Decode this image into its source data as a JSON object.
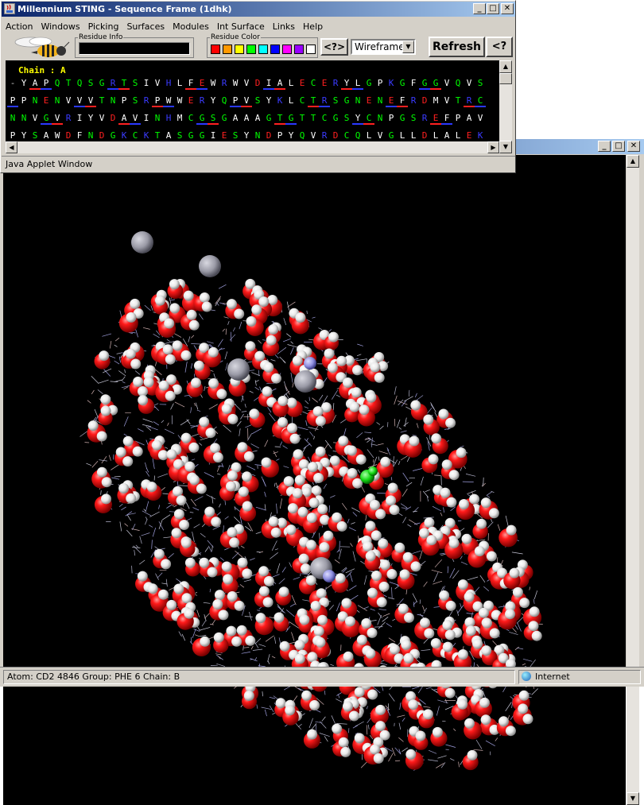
{
  "viewer": {
    "status": {
      "atom_info": "Atom: CD2 4846  Group: PHE 6  Chain: B",
      "zone": "Internet"
    }
  },
  "sequence_frame": {
    "title": "Millennium STING - Sequence Frame (1dhk)",
    "menu": [
      "Action",
      "Windows",
      "Picking",
      "Surfaces",
      "Modules",
      "Int Surface",
      "Links",
      "Help"
    ],
    "residue_info_label": "Residue Info",
    "residue_color_label": "Residue Color",
    "swatches": [
      "#ff0000",
      "#ff9900",
      "#ffff00",
      "#00ff00",
      "#00ffff",
      "#0000ff",
      "#ff00ff",
      "#9900ff",
      "#ffffff"
    ],
    "help_button": "<?>",
    "render_mode": "Wireframe",
    "refresh_button": "Refresh",
    "help_button2": "<?",
    "chain_label": "Chain : A",
    "applet_window_label": "Java Applet Window",
    "colors": {
      "Y": "#ffffff",
      "G": "#00ff00",
      "N": "#00ff00",
      "Q": "#00ff00",
      "S": "#00ff00",
      "T": "#00ff00",
      "C": "#00ff00",
      "A": "#ffffff",
      "V": "#ffffff",
      "I": "#ffffff",
      "L": "#ffffff",
      "F": "#ffffff",
      "W": "#ffffff",
      "P": "#ffffff",
      "M": "#ffffff",
      "R": "#3b3bff",
      "K": "#3b3bff",
      "H": "#3b3bff",
      "D": "#ff2020",
      "E": "#ff2020",
      "-": "#cccccc"
    },
    "sequence_lines": [
      "-YAPQTQSGRTSIVHLFEWRWVDIALECERYLGPKGFGGVQVS",
      "PPNENVVVTNPSRPWWERYQPVSYKLCTRSGNENEFRDMVTRC",
      "NNVGVRIYVDAVINHMCGSGAAAGTGTTCGSYCNPGSREFPAV",
      "PYSAWDFNDGKCKTASGGIESYNDPYQVRDCQLVGLLDLALEK"
    ]
  }
}
